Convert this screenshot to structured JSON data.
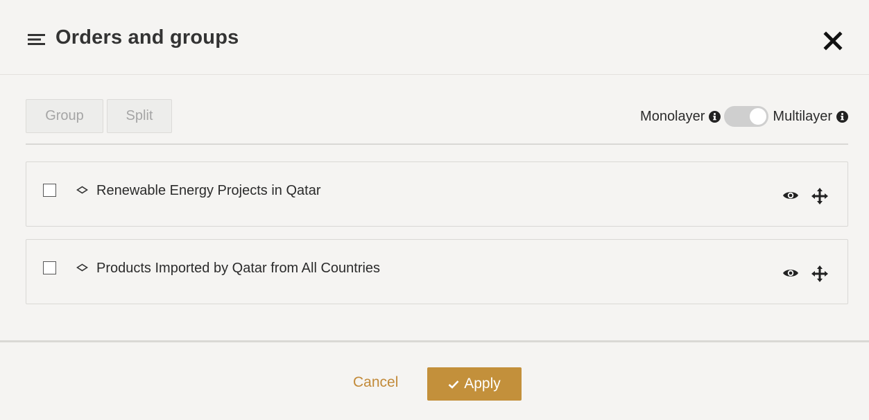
{
  "dialog": {
    "title": "Orders and groups",
    "icons": {
      "menu": "menu-lines-icon",
      "close": "close-x-icon"
    }
  },
  "toolbar": {
    "group_label": "Group",
    "split_label": "Split",
    "monolayer_label": "Monolayer",
    "multilayer_label": "Multilayer",
    "toggle_state": "multilayer"
  },
  "layers": [
    {
      "label": "Renewable Energy Projects in Qatar",
      "checked": false
    },
    {
      "label": "Products Imported by Qatar from All Countries",
      "checked": false
    }
  ],
  "footer": {
    "cancel_label": "Cancel",
    "apply_label": "Apply"
  },
  "colors": {
    "accent": "#c3903b",
    "background": "#f5f4f2",
    "disabled_text": "#a5a5a5"
  }
}
